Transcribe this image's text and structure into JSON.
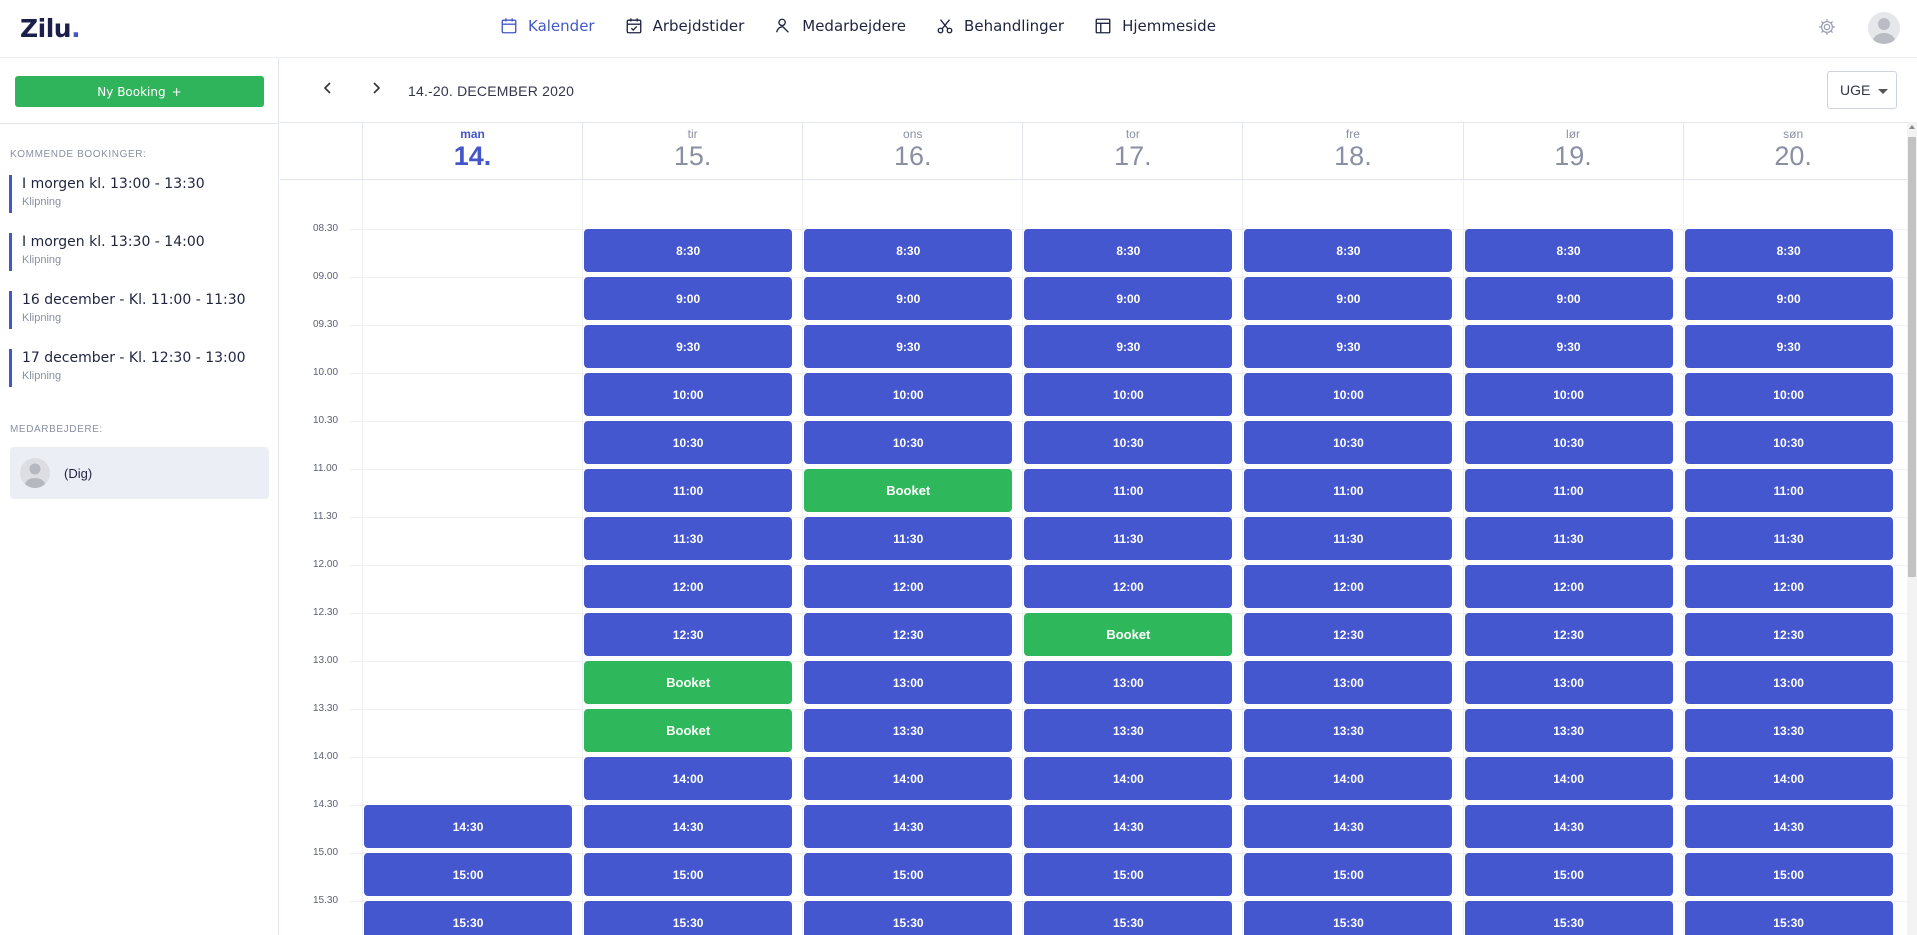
{
  "app": {
    "logo_text": "Zilu",
    "logo_dot": "."
  },
  "nav": [
    {
      "label": "Kalender",
      "icon": "calendar-icon",
      "active": true
    },
    {
      "label": "Arbejdstider",
      "icon": "calendar-check-icon",
      "active": false
    },
    {
      "label": "Medarbejdere",
      "icon": "person-icon",
      "active": false
    },
    {
      "label": "Behandlinger",
      "icon": "scissors-icon",
      "active": false
    },
    {
      "label": "Hjemmeside",
      "icon": "layout-icon",
      "active": false
    }
  ],
  "sidebar": {
    "new_booking_label": "Ny Booking",
    "new_booking_plus": "+",
    "upcoming_label": "KOMMENDE BOOKINGER:",
    "upcoming": [
      {
        "when": "I morgen kl. 13:00 - 13:30",
        "what": "Klipning"
      },
      {
        "when": "I morgen kl. 13:30 - 14:00",
        "what": "Klipning"
      },
      {
        "when": "16 december - Kl. 11:00 - 11:30",
        "what": "Klipning"
      },
      {
        "when": "17 december - Kl. 12:30 - 13:00",
        "what": "Klipning"
      }
    ],
    "staff_label": "MEDARBEJDERE:",
    "staff": [
      {
        "name": "(Dig)"
      }
    ]
  },
  "calendar": {
    "range_label": "14.-20. DECEMBER 2020",
    "view_label": "UGE",
    "days": [
      {
        "name": "man",
        "date": "14.",
        "today": true
      },
      {
        "name": "tir",
        "date": "15.",
        "today": false
      },
      {
        "name": "ons",
        "date": "16.",
        "today": false
      },
      {
        "name": "tor",
        "date": "17.",
        "today": false
      },
      {
        "name": "fre",
        "date": "18.",
        "today": false
      },
      {
        "name": "lør",
        "date": "19.",
        "today": false
      },
      {
        "name": "søn",
        "date": "20.",
        "today": false
      }
    ],
    "time_labels": [
      "08.30",
      "09.00",
      "09.30",
      "10.00",
      "10.30",
      "11.00",
      "11.30",
      "12.00",
      "12.30",
      "13.00",
      "13.30",
      "14.00",
      "14.30",
      "15.00",
      "15.30"
    ],
    "slot_times": [
      "8:30",
      "9:00",
      "9:30",
      "10:00",
      "10:30",
      "11:00",
      "11:30",
      "12:00",
      "12:30",
      "13:00",
      "13:30",
      "14:00",
      "14:30",
      "15:00",
      "15:30"
    ],
    "booked_label": "Booket",
    "booked": {
      "tir": [
        "13:00",
        "13:30"
      ],
      "ons": [
        "11:00"
      ],
      "tor": [
        "12:30"
      ]
    },
    "monday_first_slot": "14:30"
  },
  "colors": {
    "accent": "#4457c9",
    "slot": "#4457cf",
    "booked": "#2fb85b",
    "button": "#2fb35b"
  }
}
